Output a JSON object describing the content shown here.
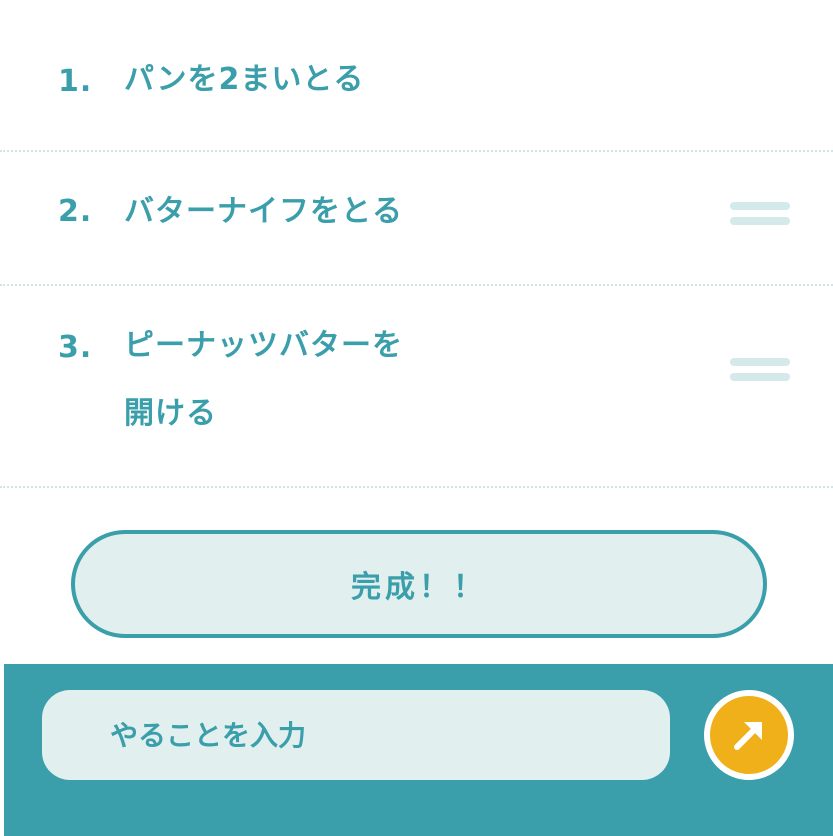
{
  "tasks": [
    {
      "number": "1.",
      "text": "パンを2まいとる",
      "has_handle": false
    },
    {
      "number": "2.",
      "text": "バターナイフをとる",
      "has_handle": true
    },
    {
      "number": "3.",
      "text": "ピーナッツバターを開ける",
      "has_handle": true
    }
  ],
  "complete_button": {
    "label": "完成！！"
  },
  "input": {
    "placeholder": "やることを入力",
    "value": ""
  },
  "submit_button": {
    "icon": "arrow-up-right-icon"
  },
  "colors": {
    "accent": "#3a9eab",
    "light_fill": "#e1efee",
    "handle": "#d3e9ea",
    "submit": "#f0b019",
    "divider": "#cfe6e6"
  }
}
